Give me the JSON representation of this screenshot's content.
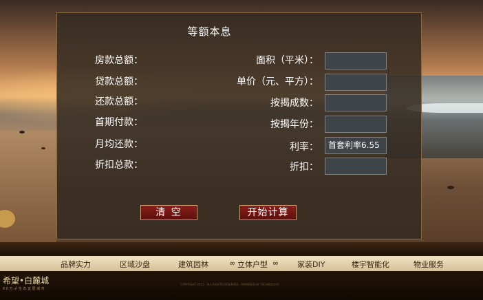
{
  "calculator": {
    "title": "等额本息",
    "results": {
      "total_price_label": "房款总额：",
      "loan_total_label": "贷款总额：",
      "repay_total_label": "还款总额：",
      "down_payment_label": "首期付款：",
      "monthly_label": "月均还款：",
      "discount_total_label": "折扣总款："
    },
    "inputs": {
      "area_label": "面积（平米）：",
      "area_value": "",
      "unit_price_label": "单价（元、平方）：",
      "unit_price_value": "",
      "mortgage_ratio_label": "按揭成数：",
      "mortgage_ratio_value": "",
      "mortgage_years_label": "按揭年份：",
      "mortgage_years_value": "",
      "rate_label": "利率：",
      "rate_value": "首套利率6.55",
      "discount_label": "折扣：",
      "discount_value": ""
    },
    "buttons": {
      "clear_label": "清 空",
      "calculate_label": "开始计算"
    }
  },
  "nav": {
    "items": [
      "品牌实力",
      "区域沙盘",
      "建筑园林",
      "立体户型",
      "家装DIY",
      "楼宇智能化",
      "物业服务"
    ],
    "deco_left": "∞",
    "deco_right": "∞"
  },
  "footer": {
    "logo": "希望•白麓城",
    "logo_sub": "8 0 万 ㎡ 生 态 宜 居 城 市",
    "copyright": "COPYRIGHT 2013 · ALL RIGHTS RESERVED · POWERED BY TECHNOLOGY"
  },
  "colors": {
    "panel": "#342b22",
    "button": "#7a1a15",
    "nav_bar": "#e6d4ae"
  }
}
